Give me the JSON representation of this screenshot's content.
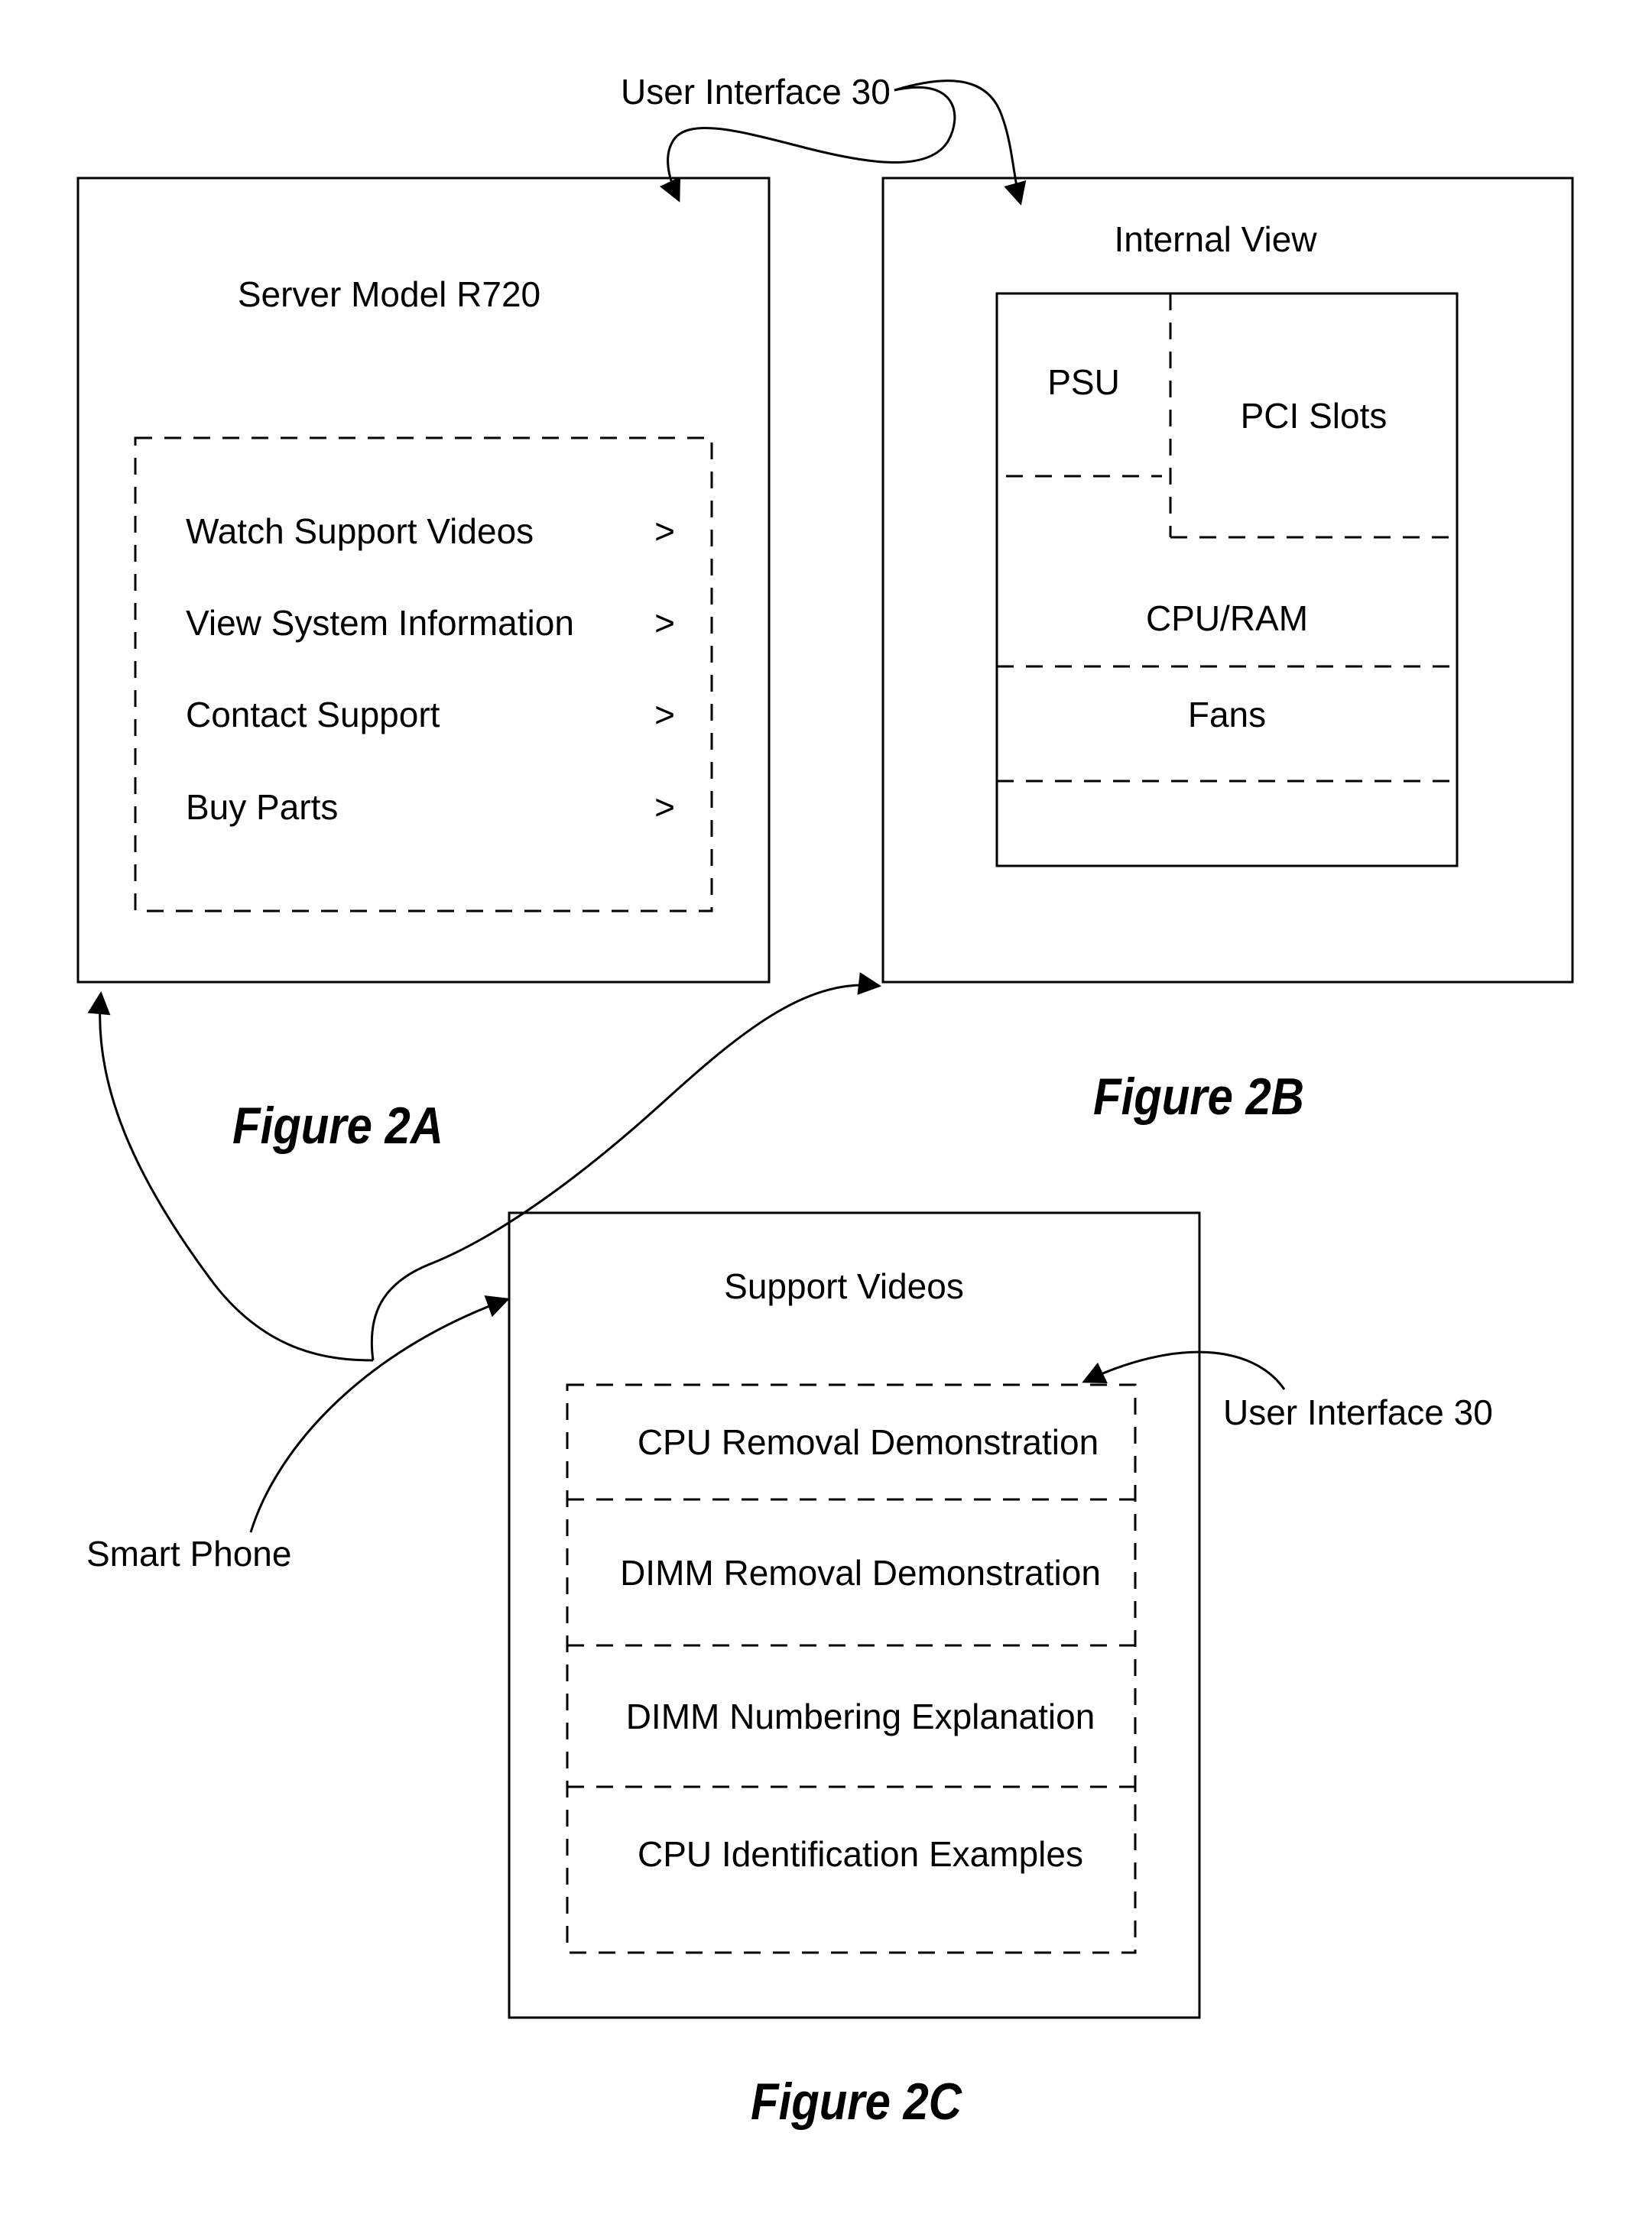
{
  "callouts": {
    "top_label": "User Interface 30",
    "right_label": "User Interface 30",
    "device_label": "Smart Phone"
  },
  "figure_2a": {
    "caption": "Figure 2A",
    "title": "Server Model R720",
    "menu": [
      {
        "label": "Watch Support Videos",
        "chevron": ">"
      },
      {
        "label": "View System Information",
        "chevron": ">"
      },
      {
        "label": "Contact Support",
        "chevron": ">"
      },
      {
        "label": "Buy Parts",
        "chevron": ">"
      }
    ]
  },
  "figure_2b": {
    "caption": "Figure 2B",
    "title": "Internal View",
    "regions": {
      "psu": "PSU",
      "pci": "PCI Slots",
      "cpu_ram": "CPU/RAM",
      "fans": "Fans"
    }
  },
  "figure_2c": {
    "caption": "Figure 2C",
    "title": "Support Videos",
    "videos": [
      "CPU Removal Demonstration",
      "DIMM Removal Demonstration",
      "DIMM Numbering Explanation",
      "CPU Identification Examples"
    ]
  }
}
